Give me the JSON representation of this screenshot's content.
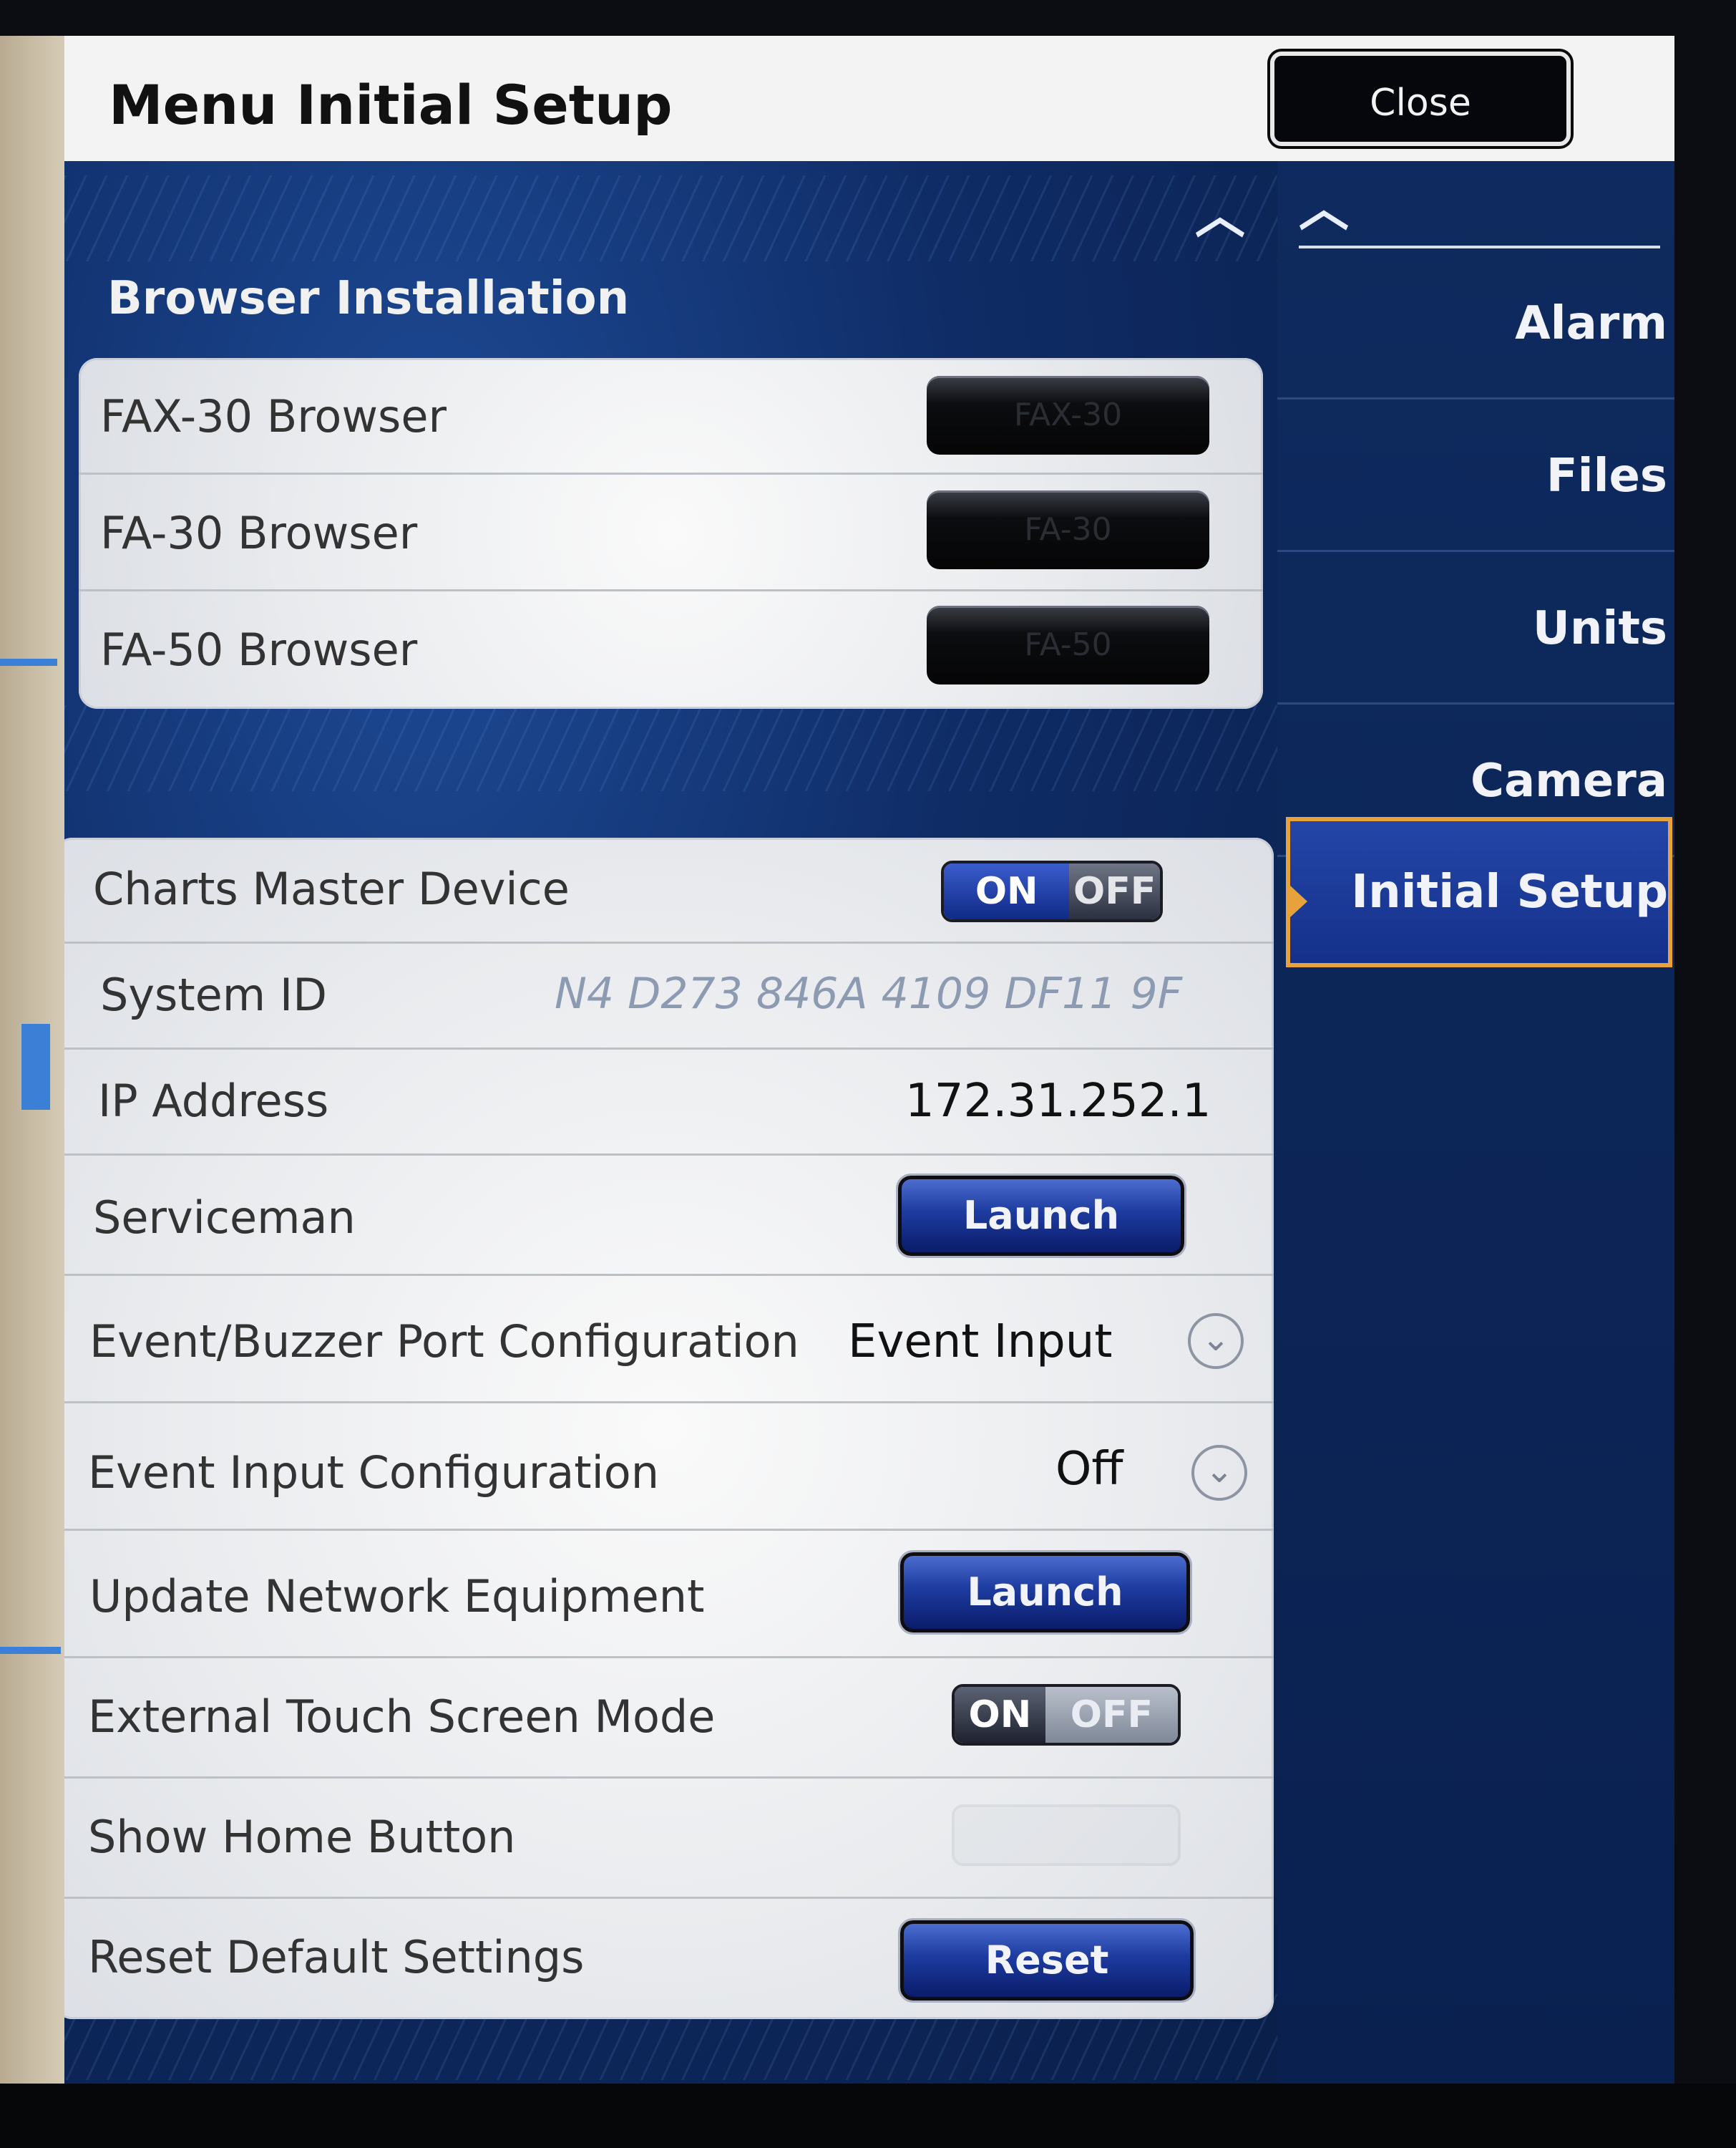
{
  "header": {
    "title": "Menu Initial Setup",
    "close_label": "Close"
  },
  "browser_section": {
    "title": "Browser Installation",
    "rows": [
      {
        "label": "FAX-30 Browser",
        "button": "FAX-30"
      },
      {
        "label": "FA-30 Browser",
        "button": "FA-30"
      },
      {
        "label": "FA-50 Browser",
        "button": "FA-50"
      }
    ]
  },
  "settings": {
    "charts_master": {
      "label": "Charts Master Device",
      "on": "ON",
      "off": "OFF"
    },
    "system_id": {
      "label": "System ID",
      "value": "N4 D273 846A 4109 DF11 9F"
    },
    "ip_address": {
      "label": "IP Address",
      "value": "172.31.252.1"
    },
    "serviceman": {
      "label": "Serviceman",
      "button": "Launch"
    },
    "event_buzzer": {
      "label": "Event/Buzzer Port Configuration",
      "value": "Event Input"
    },
    "event_input": {
      "label": "Event Input Configuration",
      "value": "Off"
    },
    "update_network": {
      "label": "Update Network Equipment",
      "button": "Launch"
    },
    "external_touch": {
      "label": "External Touch Screen Mode",
      "on": "ON",
      "off": "OFF"
    },
    "show_home": {
      "label": "Show Home Button"
    },
    "reset_defaults": {
      "label": "Reset Default Settings",
      "button": "Reset"
    }
  },
  "sidebar": {
    "items": [
      {
        "label": "Alarm"
      },
      {
        "label": "Files"
      },
      {
        "label": "Units"
      },
      {
        "label": "Camera"
      },
      {
        "label": "Initial Setup"
      }
    ],
    "active_index": 4
  },
  "colors": {
    "accent": "#e7a23b",
    "panel": "#0e2756",
    "button_blue": "#1d3b9f"
  },
  "icons": [
    "chevron-up-icon",
    "chevron-down-icon"
  ]
}
